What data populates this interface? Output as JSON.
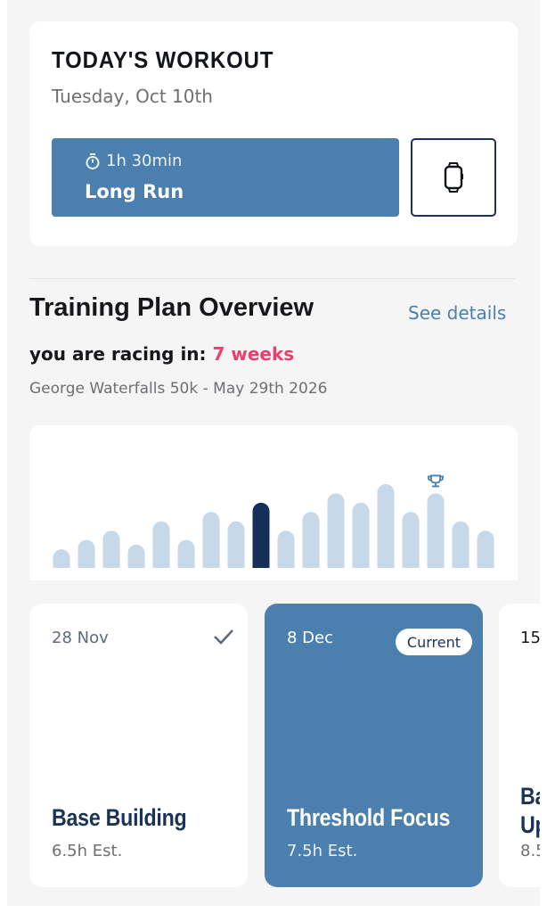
{
  "workout": {
    "title": "TODAY'S WORKOUT",
    "date": "Tuesday, Oct 10th",
    "duration": "1h 30min",
    "name": "Long Run"
  },
  "plan": {
    "title": "Training Plan Overview",
    "see_details": "See details",
    "racing_label": "you are racing in:",
    "racing_weeks": "7 weeks",
    "race_name": "George Waterfalls 50k - May 29th 2026"
  },
  "chart_data": {
    "type": "bar",
    "values": [
      2,
      3,
      4,
      2.5,
      5,
      3,
      6,
      5,
      7,
      4,
      6,
      8,
      7,
      9,
      6,
      8,
      5,
      4
    ],
    "current_index": 8,
    "race_index": 15,
    "colors": {
      "default": "#c7d9e9",
      "current": "#14305a",
      "trophy": "#4a7fae"
    }
  },
  "weeks": [
    {
      "date": "28 Nov",
      "name": "Base Building",
      "est": "6.5h Est.",
      "completed": true
    },
    {
      "date": "8 Dec",
      "badge": "Current",
      "name": "Threshold Focus",
      "est": "7.5h Est."
    },
    {
      "date": "15",
      "name": "Ba Up",
      "est": "8.5"
    }
  ],
  "colors": {
    "accent": "#4a7fae",
    "navy": "#1a3358",
    "highlight": "#ec3f6e",
    "background": "#f5f5f6"
  },
  "icons": [
    "stopwatch-icon",
    "smartwatch-icon",
    "checkmark-icon",
    "trophy-icon"
  ]
}
